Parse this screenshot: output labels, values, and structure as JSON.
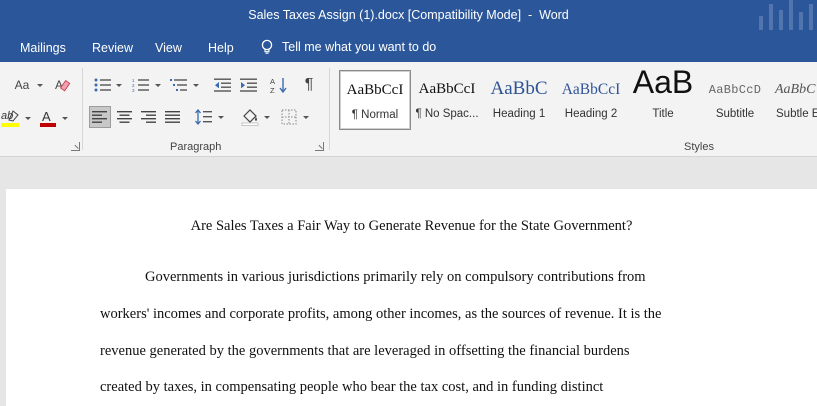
{
  "window": {
    "doc_title": "Sales Taxes Assign (1).docx [Compatibility Mode]",
    "separator": "-",
    "app_name": "Word"
  },
  "menu": {
    "tabs": [
      "Mailings",
      "Review",
      "View",
      "Help"
    ],
    "tell_me": "Tell me what you want to do"
  },
  "ribbon": {
    "font_case_label": "Aa",
    "paragraph_label": "Paragraph",
    "styles_label": "Styles"
  },
  "styles": [
    {
      "sample": "AaBbCcI",
      "name": "¶ Normal"
    },
    {
      "sample": "AaBbCcI",
      "name": "¶ No Spac..."
    },
    {
      "sample": "AaBbC",
      "name": "Heading 1"
    },
    {
      "sample": "AaBbCcI",
      "name": "Heading 2"
    },
    {
      "sample": "AaB",
      "name": "Title"
    },
    {
      "sample": "AaBbCcD",
      "name": "Subtitle"
    },
    {
      "sample": "AaBbC",
      "name": "Subtle E"
    }
  ],
  "colors": {
    "brand": "#2b579a",
    "highlight": "#ffff00",
    "font_color": "#c00000"
  },
  "document": {
    "heading": "Are Sales Taxes a Fair Way to Generate Revenue for the State Government?",
    "lines": [
      "Governments in various jurisdictions primarily rely on compulsory contributions from",
      "workers' incomes and corporate profits, among other incomes, as the sources of revenue. It is the",
      "revenue generated by the governments that are leveraged in offsetting the financial burdens",
      "created by taxes, in compensating people who bear the tax cost, and in funding distinct"
    ]
  }
}
